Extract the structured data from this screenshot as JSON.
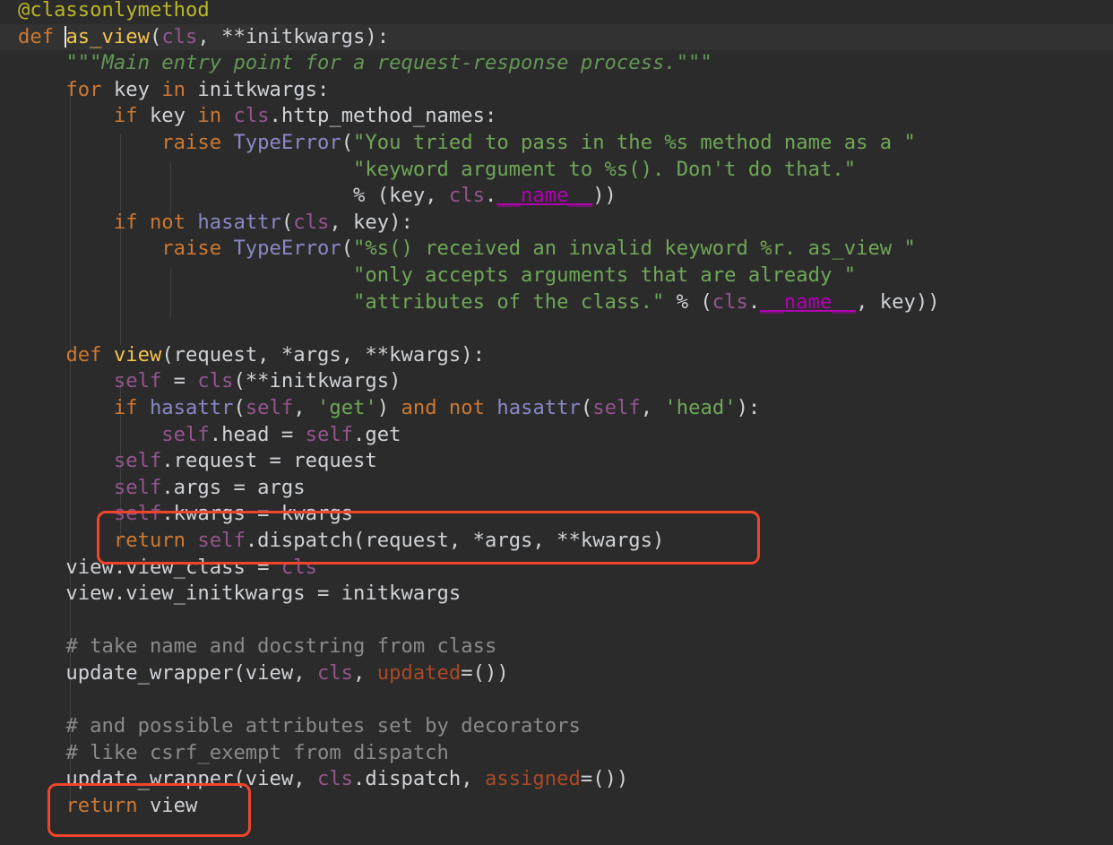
{
  "editor": {
    "colors": {
      "background": "#2b2b2b",
      "keyword": "#cc7832",
      "function_name": "#f4c451",
      "string": "#6fa757",
      "comment": "#8a8a8a",
      "builtin": "#8888c6",
      "dunder": "#b200b2",
      "annotation_box": "#f0452c"
    },
    "lines": [
      [
        {
          "t": "@classonlymethod",
          "c": "deco"
        }
      ],
      [
        {
          "t": "def ",
          "c": "kw"
        },
        {
          "t": "",
          "c": "caret"
        },
        {
          "t": "as_view",
          "c": "fn"
        },
        {
          "t": "(",
          "c": "pl"
        },
        {
          "t": "cls",
          "c": "self"
        },
        {
          "t": ", **initkwargs):",
          "c": "pl"
        }
      ],
      [
        {
          "t": "    ",
          "c": "pl"
        },
        {
          "t": "\"\"\"Main entry point for a request-response process.\"\"\"",
          "c": "doc"
        }
      ],
      [
        {
          "t": "    ",
          "c": "pl"
        },
        {
          "t": "for ",
          "c": "kw"
        },
        {
          "t": "key ",
          "c": "pl"
        },
        {
          "t": "in ",
          "c": "kw"
        },
        {
          "t": "initkwargs:",
          "c": "pl"
        }
      ],
      [
        {
          "t": "        ",
          "c": "pl"
        },
        {
          "t": "if ",
          "c": "kw"
        },
        {
          "t": "key ",
          "c": "pl"
        },
        {
          "t": "in ",
          "c": "kw"
        },
        {
          "t": "cls",
          "c": "self"
        },
        {
          "t": ".http_method_names:",
          "c": "pl"
        }
      ],
      [
        {
          "t": "            ",
          "c": "pl"
        },
        {
          "t": "raise ",
          "c": "kw"
        },
        {
          "t": "TypeError",
          "c": "bi"
        },
        {
          "t": "(",
          "c": "pl"
        },
        {
          "t": "\"You tried to pass in the %s method name as a \"",
          "c": "str"
        }
      ],
      [
        {
          "t": "                            ",
          "c": "pl"
        },
        {
          "t": "\"keyword argument to %s(). Don't do that.\"",
          "c": "str"
        }
      ],
      [
        {
          "t": "                            % (key, ",
          "c": "pl"
        },
        {
          "t": "cls",
          "c": "self"
        },
        {
          "t": ".",
          "c": "pl"
        },
        {
          "t": "__name__",
          "c": "magic"
        },
        {
          "t": "))",
          "c": "pl"
        }
      ],
      [
        {
          "t": "        ",
          "c": "pl"
        },
        {
          "t": "if not ",
          "c": "kw"
        },
        {
          "t": "hasattr",
          "c": "bi"
        },
        {
          "t": "(",
          "c": "pl"
        },
        {
          "t": "cls",
          "c": "self"
        },
        {
          "t": ", key):",
          "c": "pl"
        }
      ],
      [
        {
          "t": "            ",
          "c": "pl"
        },
        {
          "t": "raise ",
          "c": "kw"
        },
        {
          "t": "TypeError",
          "c": "bi"
        },
        {
          "t": "(",
          "c": "pl"
        },
        {
          "t": "\"%s() received an invalid keyword %r. as_view \"",
          "c": "str"
        }
      ],
      [
        {
          "t": "                            ",
          "c": "pl"
        },
        {
          "t": "\"only accepts arguments that are already \"",
          "c": "str"
        }
      ],
      [
        {
          "t": "                            ",
          "c": "pl"
        },
        {
          "t": "\"attributes of the class.\"",
          "c": "str"
        },
        {
          "t": " % (",
          "c": "pl"
        },
        {
          "t": "cls",
          "c": "self"
        },
        {
          "t": ".",
          "c": "pl"
        },
        {
          "t": "__name__",
          "c": "magic"
        },
        {
          "t": ", key))",
          "c": "pl"
        }
      ],
      [],
      [
        {
          "t": "    ",
          "c": "pl"
        },
        {
          "t": "def ",
          "c": "kw"
        },
        {
          "t": "view",
          "c": "fn"
        },
        {
          "t": "(request, *args, **kwargs):",
          "c": "pl"
        }
      ],
      [
        {
          "t": "        ",
          "c": "pl"
        },
        {
          "t": "self ",
          "c": "self"
        },
        {
          "t": "= ",
          "c": "pl"
        },
        {
          "t": "cls",
          "c": "self"
        },
        {
          "t": "(**initkwargs)",
          "c": "pl"
        }
      ],
      [
        {
          "t": "        ",
          "c": "pl"
        },
        {
          "t": "if ",
          "c": "kw"
        },
        {
          "t": "hasattr",
          "c": "bi"
        },
        {
          "t": "(",
          "c": "pl"
        },
        {
          "t": "self",
          "c": "self"
        },
        {
          "t": ", ",
          "c": "pl"
        },
        {
          "t": "'get'",
          "c": "str"
        },
        {
          "t": ") ",
          "c": "pl"
        },
        {
          "t": "and not ",
          "c": "kw"
        },
        {
          "t": "hasattr",
          "c": "bi"
        },
        {
          "t": "(",
          "c": "pl"
        },
        {
          "t": "self",
          "c": "self"
        },
        {
          "t": ", ",
          "c": "pl"
        },
        {
          "t": "'head'",
          "c": "str"
        },
        {
          "t": "):",
          "c": "pl"
        }
      ],
      [
        {
          "t": "            ",
          "c": "pl"
        },
        {
          "t": "self",
          "c": "self"
        },
        {
          "t": ".head = ",
          "c": "pl"
        },
        {
          "t": "self",
          "c": "self"
        },
        {
          "t": ".get",
          "c": "pl"
        }
      ],
      [
        {
          "t": "        ",
          "c": "pl"
        },
        {
          "t": "self",
          "c": "self"
        },
        {
          "t": ".request = request",
          "c": "pl"
        }
      ],
      [
        {
          "t": "        ",
          "c": "pl"
        },
        {
          "t": "self",
          "c": "self"
        },
        {
          "t": ".args = args",
          "c": "pl"
        }
      ],
      [
        {
          "t": "        ",
          "c": "pl"
        },
        {
          "t": "self",
          "c": "self"
        },
        {
          "t": ".kwargs = kwargs",
          "c": "pl"
        }
      ],
      [
        {
          "t": "        ",
          "c": "pl"
        },
        {
          "t": "return ",
          "c": "kw"
        },
        {
          "t": "self",
          "c": "self"
        },
        {
          "t": ".dispatch(request, *args, **kwargs)",
          "c": "pl"
        }
      ],
      [
        {
          "t": "    view.view_class = ",
          "c": "pl"
        },
        {
          "t": "cls",
          "c": "self"
        }
      ],
      [
        {
          "t": "    view.view_initkwargs = initkwargs",
          "c": "pl"
        }
      ],
      [],
      [
        {
          "t": "    ",
          "c": "pl"
        },
        {
          "t": "# take name and docstring from class",
          "c": "cmt"
        }
      ],
      [
        {
          "t": "    update_wrapper(view, ",
          "c": "pl"
        },
        {
          "t": "cls",
          "c": "self"
        },
        {
          "t": ", ",
          "c": "pl"
        },
        {
          "t": "updated",
          "c": "pn"
        },
        {
          "t": "=())",
          "c": "pl"
        }
      ],
      [],
      [
        {
          "t": "    ",
          "c": "pl"
        },
        {
          "t": "# and possible attributes set by decorators",
          "c": "cmt"
        }
      ],
      [
        {
          "t": "    ",
          "c": "pl"
        },
        {
          "t": "# like csrf_exempt from dispatch",
          "c": "cmt"
        }
      ],
      [
        {
          "t": "    update_wrapper(view, ",
          "c": "pl"
        },
        {
          "t": "cls",
          "c": "self"
        },
        {
          "t": ".dispatch, ",
          "c": "pl"
        },
        {
          "t": "assigned",
          "c": "pn"
        },
        {
          "t": "=())",
          "c": "pl"
        }
      ],
      [
        {
          "t": "    ",
          "c": "pl"
        },
        {
          "t": "return ",
          "c": "kw"
        },
        {
          "t": "view",
          "c": "pl"
        }
      ]
    ]
  }
}
